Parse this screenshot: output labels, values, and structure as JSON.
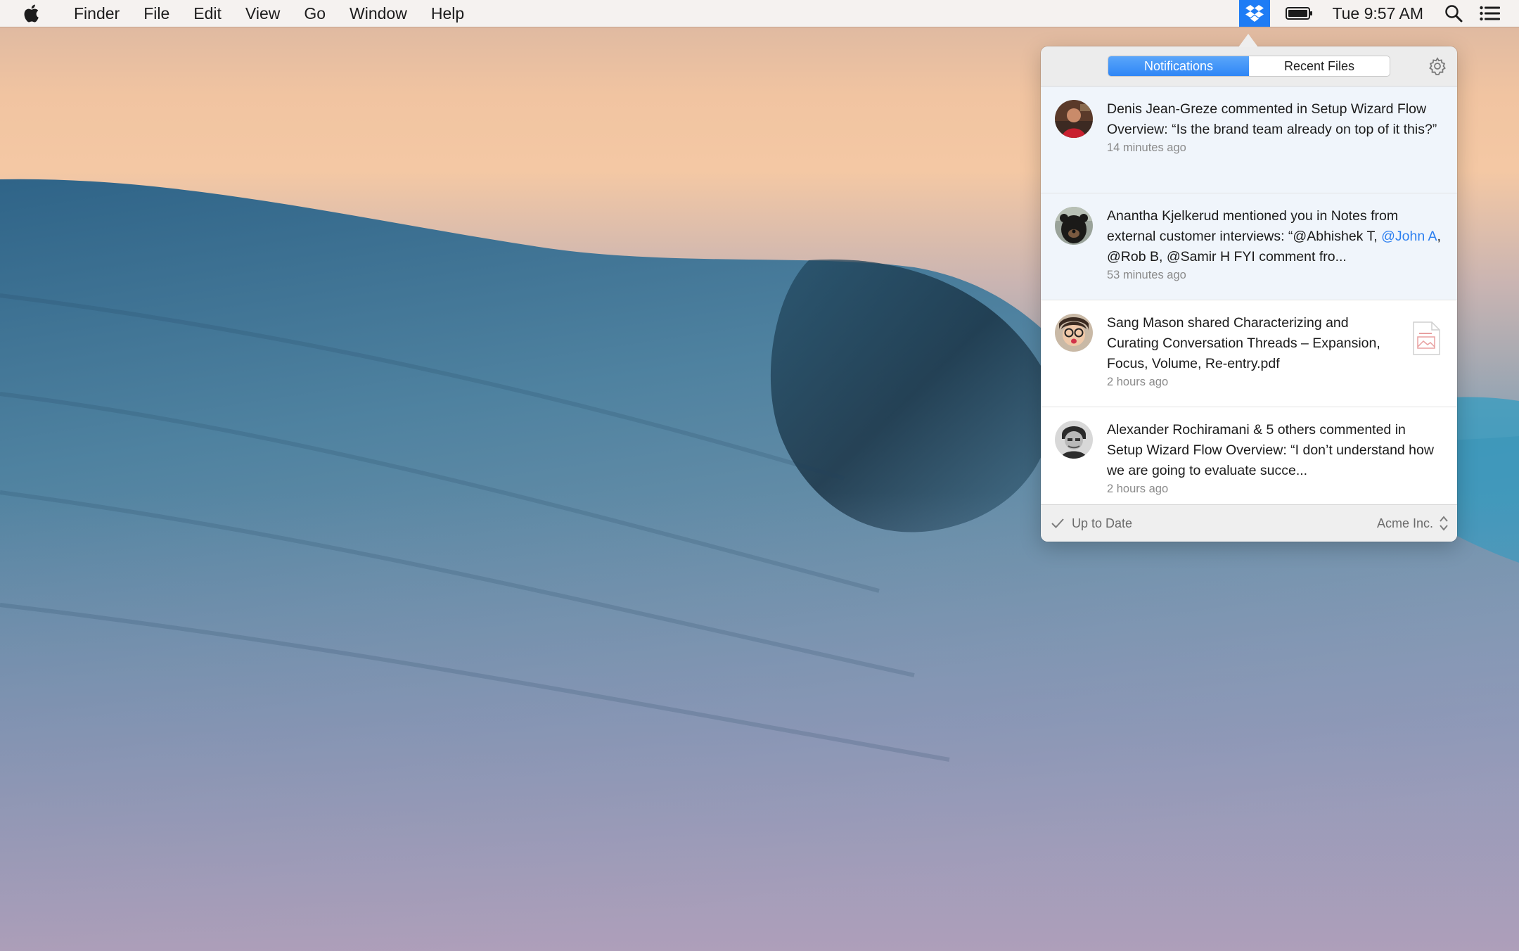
{
  "menubar": {
    "app_name": "Finder",
    "items": [
      "File",
      "Edit",
      "View",
      "Go",
      "Window",
      "Help"
    ],
    "clock": "Tue 9:57 AM"
  },
  "popover": {
    "tabs": [
      "Notifications",
      "Recent Files"
    ],
    "active_tab": "Notifications",
    "notifications": [
      {
        "text": "Denis Jean-Greze commented in Setup Wizard Flow Overview: “Is the brand team already on top of it this?”",
        "time": "14 minutes ago"
      },
      {
        "text_before": "Anantha Kjelkerud mentioned you in Notes from external customer interviews: “@Abhishek T, ",
        "mention": "@John A",
        "text_after": ", @Rob B, @Samir H FYI comment fro...",
        "time": "53 minutes ago"
      },
      {
        "text": "Sang Mason shared Characterizing and Curating Conversation Threads – Expansion, Focus, Volume, Re-entry.pdf",
        "time": "2 hours ago"
      },
      {
        "text": "Alexander Rochiramani & 5 others commented in Setup Wizard Flow Overview: “I don’t understand how we are going to evaluate succe...",
        "time": "2 hours ago"
      }
    ],
    "footer": {
      "status": "Up to Date",
      "account": "Acme Inc."
    }
  },
  "colors": {
    "accent": "#1e7cf5",
    "mention": "#2c7ff0"
  }
}
